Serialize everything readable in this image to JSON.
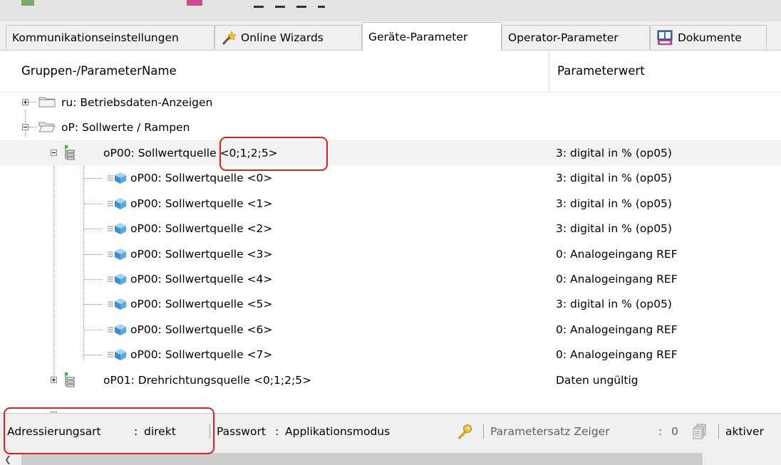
{
  "tabs": [
    {
      "label": "Kommunikationseinstellungen",
      "icon": null
    },
    {
      "label": "Online Wizards",
      "icon": "wand-icon"
    },
    {
      "label": "Geräte-Parameter",
      "icon": null,
      "active": true
    },
    {
      "label": "Operator-Parameter",
      "icon": null
    },
    {
      "label": "Dokumente",
      "icon": "keb-docs-icon"
    }
  ],
  "columns": {
    "name": "Gruppen-/ParameterName",
    "value": "Parameterwert"
  },
  "tree": {
    "ru": {
      "label": "ru: Betriebsdaten-Anzeigen",
      "value": ""
    },
    "op": {
      "label": "oP: Sollwerte / Rampen",
      "value": ""
    },
    "op00": {
      "label": "oP00: Sollwertquelle <0;1;2;5>",
      "value": "3: digital in % (op05)"
    },
    "children": [
      {
        "label": "oP00: Sollwertquelle <0>",
        "value": "3: digital in % (op05)"
      },
      {
        "label": "oP00: Sollwertquelle <1>",
        "value": "3: digital in % (op05)"
      },
      {
        "label": "oP00: Sollwertquelle <2>",
        "value": "3: digital in % (op05)"
      },
      {
        "label": "oP00: Sollwertquelle <3>",
        "value": "0: Analogeingang REF"
      },
      {
        "label": "oP00: Sollwertquelle <4>",
        "value": "0: Analogeingang REF"
      },
      {
        "label": "oP00: Sollwertquelle <5>",
        "value": "3: digital in % (op05)"
      },
      {
        "label": "oP00: Sollwertquelle <6>",
        "value": "0: Analogeingang REF"
      },
      {
        "label": "oP00: Sollwertquelle <7>",
        "value": "0: Analogeingang REF"
      }
    ],
    "op01": {
      "label": "oP01: Drehrichtungsquelle <0;1;2;5>",
      "value": "Daten ungültig"
    }
  },
  "status": {
    "address_label": "Adressierungsart",
    "address_value": "direkt",
    "password_label": "Passwort",
    "password_value": "Applikationsmodus",
    "paramset_label": "Parametersatz Zeiger",
    "paramset_value": "0",
    "active_text": "aktiver"
  },
  "colors": {
    "highlight": "#e02020",
    "tab_bg": "#f0f0f0",
    "selected_row": "#f2f2f2"
  }
}
